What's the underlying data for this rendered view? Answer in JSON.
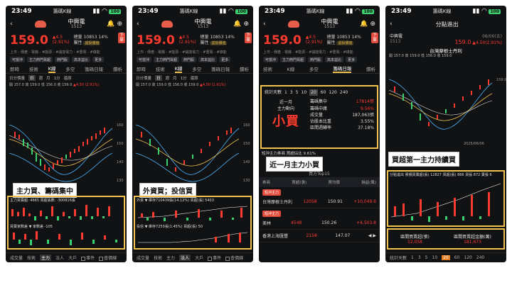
{
  "status": {
    "time": "23:49",
    "app": "籌碼K線",
    "battery": "100"
  },
  "stock": {
    "name": "中興電",
    "code": "1513",
    "price": "159.0",
    "change": "▲4.5",
    "pct": "(2.91%)",
    "volume_label": "總量",
    "volume": "10853",
    "vol_pct": "14%",
    "attr_label": "屬性",
    "attr": "認投價值"
  },
  "stats_line": "上市 - 傳產 - 電機 - #能源 - #儲能電力 - #重電 - #綠能",
  "chips": [
    "可當沖",
    "主力熱門買超",
    "熱門股",
    "高本益比",
    "更多"
  ],
  "tabs": [
    "即時",
    "技術",
    "K線",
    "多空",
    "籌碼日報",
    "鑽析"
  ],
  "subbar": [
    "日分價量",
    "日",
    "週",
    "月",
    "1分",
    "還原"
  ],
  "legend": {
    "ohlc": "開 157.0 高 159.0 低 156.0 收 159.0",
    "chg": "▲4.50 (2.91%)"
  },
  "y_axis": [
    "160",
    "150",
    "140",
    "130"
  ],
  "p1": {
    "label": "主力買、籌碼集中",
    "ind1": "主力買賣超: 4665  買超張數: -300816張",
    "ind2": "買賣家數差 ▼  家數差 -105"
  },
  "p2": {
    "label": "外資買；投信買",
    "ind1": "外資  ▼  庫存710439張(14.12%)  買超(張) 5403",
    "ind2": "投信  ▼  庫存7250張(1.45%)  買超(張) 50"
  },
  "p3": {
    "filter_label": "統計天數",
    "days": [
      "1",
      "3",
      "5",
      "10",
      "20",
      "60",
      "120",
      "240"
    ],
    "days_selected": "20",
    "period": "近一月",
    "direction_label": "主力動向",
    "verdict": "小買",
    "rows": [
      {
        "k": "籌碼集中",
        "v": "17814張"
      },
      {
        "k": "籌碼中庸",
        "v": "9.56%"
      },
      {
        "k": "成交量",
        "v": "187,063張"
      },
      {
        "k": "佔股本比重",
        "v": "3.55%"
      },
      {
        "k": "區間週轉率",
        "v": "37.18%"
      }
    ],
    "label": "近一月主力小買",
    "table_tab": "買方Top15",
    "table_head": [
      "券商",
      "買超(張)",
      "買均價",
      "損益(萬)"
    ],
    "brokers": [
      {
        "tag": "短沖主力",
        "name": "台灣摩根士丹利",
        "buy": "12058",
        "avg": "150.91",
        "pl": "+10,049.6"
      },
      {
        "tag": "短沖主力",
        "name": "美林",
        "buy": "4548",
        "avg": "150.26",
        "pl": "+4,503.8"
      },
      {
        "tag": "",
        "name": "香港上海匯豐",
        "buy": "2158",
        "avg": "147.07",
        "pl": ""
      }
    ],
    "note": "短沖主力券商  買超佔比 9.61%"
  },
  "p4": {
    "title": "分點進出",
    "stock": "中興電",
    "code": "1513",
    "price": "159.0",
    "change": "▲4.50(2.91%)",
    "date": "06/06(五)",
    "broker": "台灣摩根士丹利",
    "label": "買超第一主力持續買",
    "ind": "分點進出  累積買賣超(張) 12827  買超(張) 866  買張 872  賣張 6",
    "left_label": "區間買賣超(張)",
    "left_val": "12,058",
    "right_label": "區間買賣超金額(萬)",
    "right_val": "181,673",
    "filter_label": "統計天數",
    "days": [
      "1",
      "3",
      "5",
      "10",
      "20",
      "60",
      "120",
      "240"
    ],
    "days_selected": "20",
    "chart_date": "2025/06/06"
  },
  "bottomnav": [
    "成交量",
    "技術",
    "主力",
    "法人",
    "大戶"
  ],
  "bottom_opts": [
    "事件",
    "查價線"
  ]
}
